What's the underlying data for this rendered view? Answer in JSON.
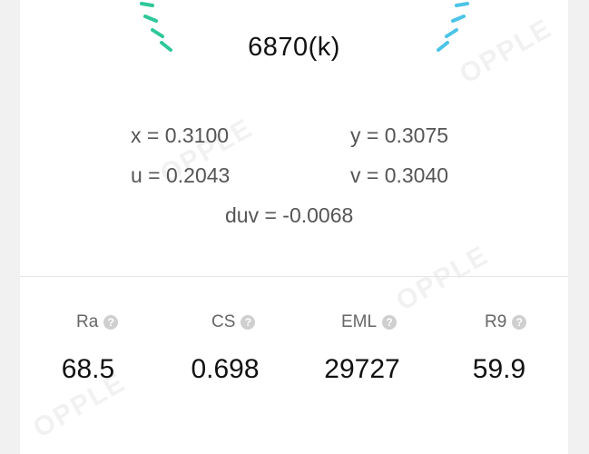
{
  "cct": {
    "value": "6870(k)"
  },
  "coordinates": {
    "x": "x = 0.3100",
    "y": "y = 0.3075",
    "u": "u = 0.2043",
    "v": "v = 0.3040",
    "duv": "duv = -0.0068"
  },
  "metrics": [
    {
      "label": "Ra",
      "value": "68.5"
    },
    {
      "label": "CS",
      "value": "0.698"
    },
    {
      "label": "EML",
      "value": "29727"
    },
    {
      "label": "R9",
      "value": "59.9"
    }
  ],
  "help_glyph": "?",
  "watermark": "OPPLE",
  "colors": {
    "gauge_left": "#2ec89a",
    "gauge_right": "#4cc4e8"
  }
}
